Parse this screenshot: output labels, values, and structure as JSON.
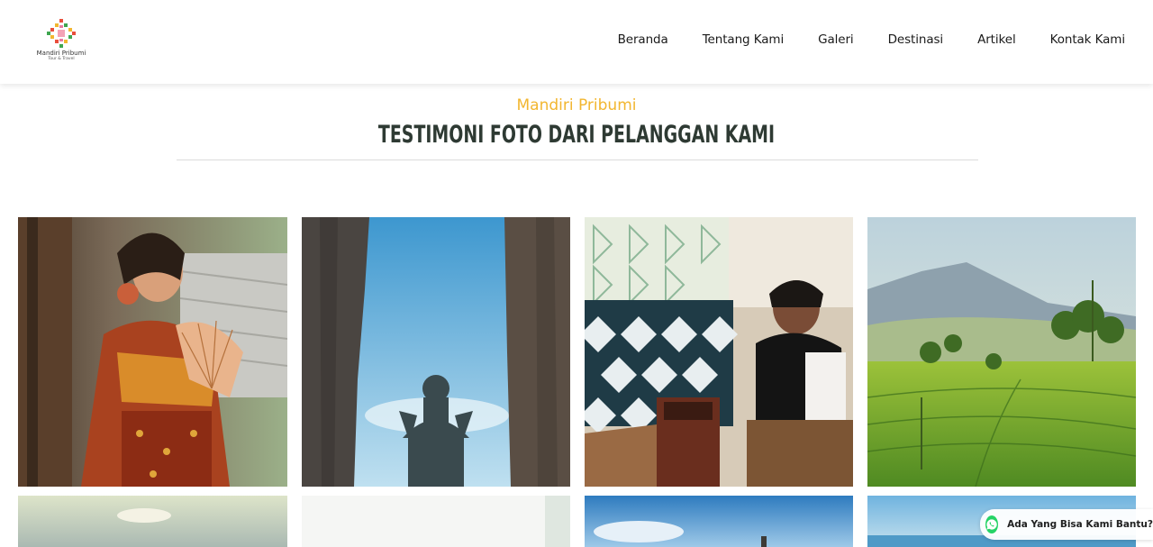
{
  "brand": {
    "name": "Mandiri Pribumi",
    "tagline": "Tour & Travel"
  },
  "nav": {
    "items": [
      {
        "label": "Beranda"
      },
      {
        "label": "Tentang Kami"
      },
      {
        "label": "Galeri"
      },
      {
        "label": "Destinasi"
      },
      {
        "label": "Artikel"
      },
      {
        "label": "Kontak Kami"
      }
    ]
  },
  "section": {
    "eyebrow": "Mandiri Pribumi",
    "title": "TESTIMONI FOTO DARI PELANGGAN KAMI"
  },
  "gallery": {
    "photos": [
      {
        "subject": "balinese-dancer-photo"
      },
      {
        "subject": "gwk-statue-photo"
      },
      {
        "subject": "batik-artisan-photo"
      },
      {
        "subject": "rice-terrace-photo"
      },
      {
        "subject": "sky-landscape-photo"
      },
      {
        "subject": "light-photo"
      },
      {
        "subject": "temple-sky-photo"
      },
      {
        "subject": "beach-photo"
      }
    ]
  },
  "whatsapp": {
    "label": "Ada Yang Bisa Kami Bantu?",
    "icon": "whatsapp-icon",
    "color": "#25d366"
  },
  "colors": {
    "accent": "#f2b630",
    "heading": "#2e3a33"
  }
}
